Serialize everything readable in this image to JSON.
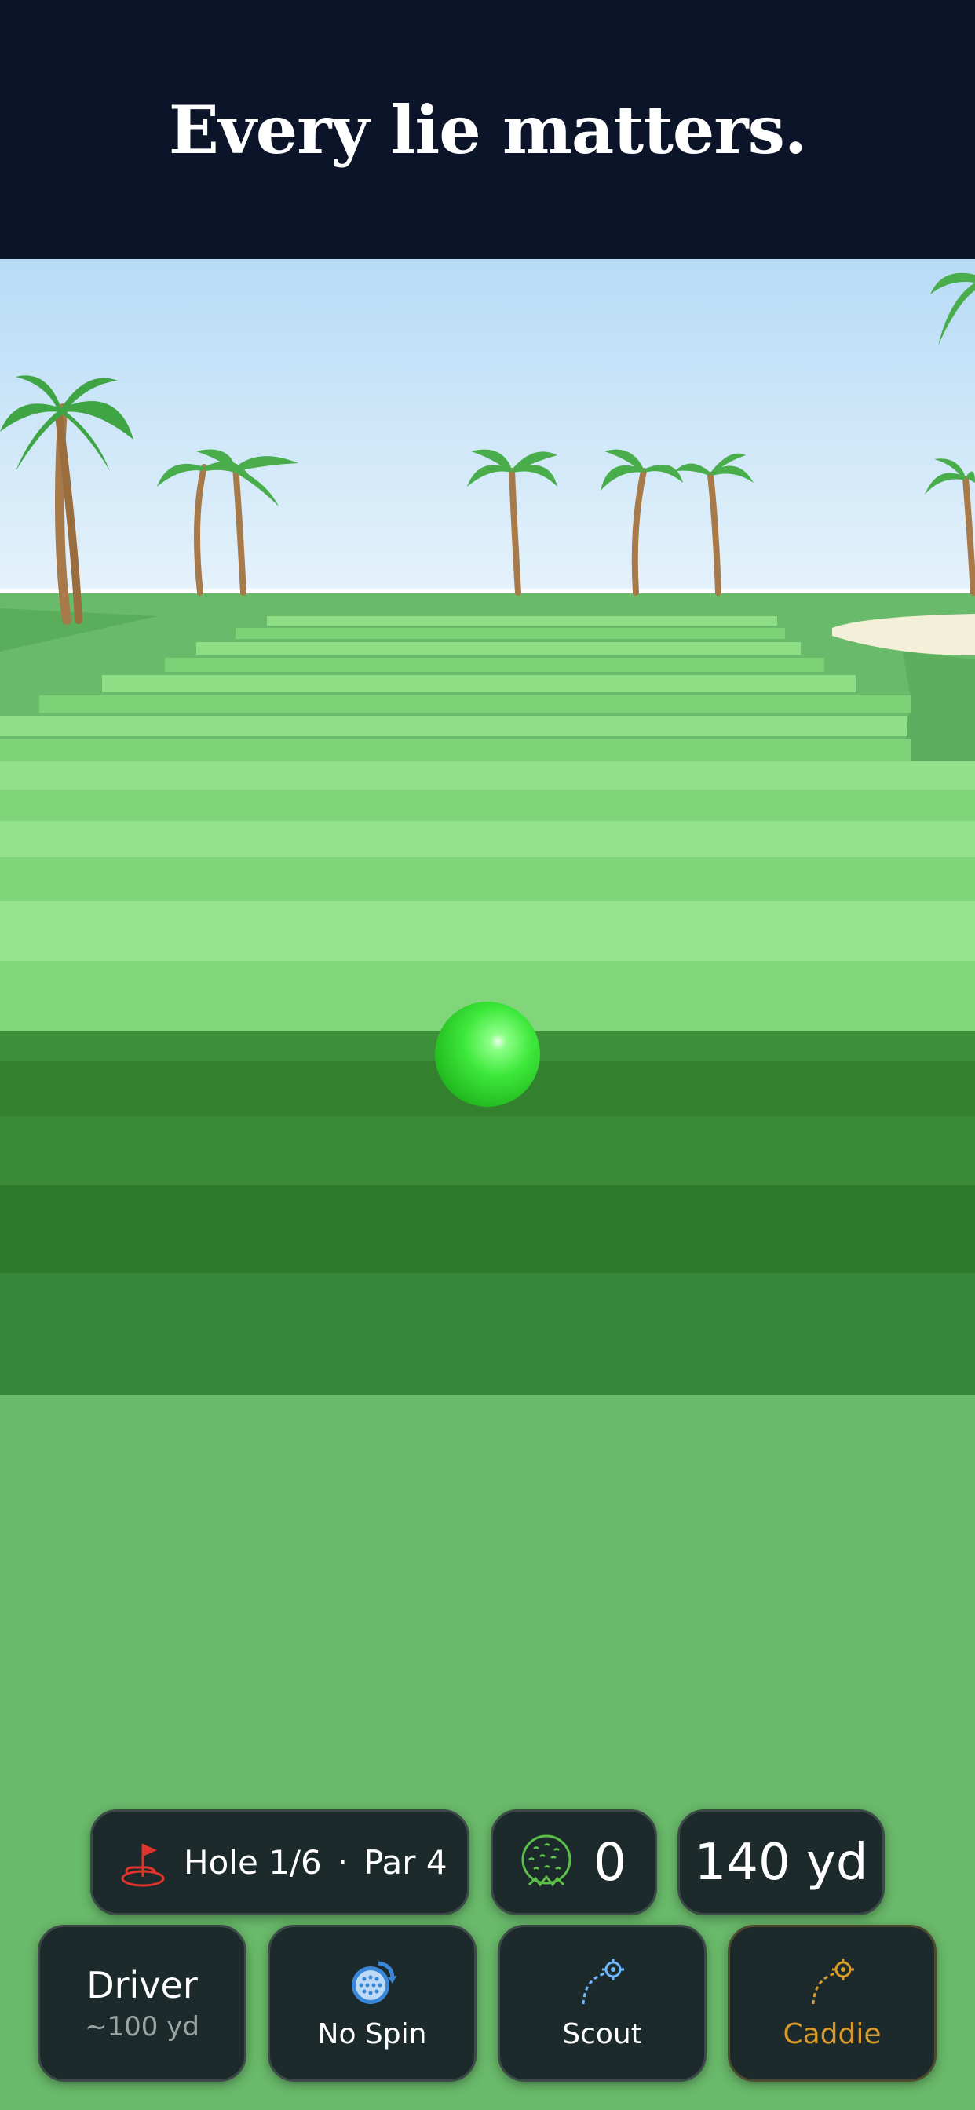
{
  "banner": {
    "title": "Every lie matters."
  },
  "hud": {
    "hole": {
      "label": "Hole 1/6",
      "separator": "·",
      "par": "Par 4"
    },
    "strokes": "0",
    "distance": "140 yd"
  },
  "controls": {
    "club": {
      "name": "Driver",
      "range": "~100 yd"
    },
    "spin": {
      "label": "No Spin"
    },
    "scout": {
      "label": "Scout"
    },
    "caddie": {
      "label": "Caddie"
    }
  },
  "colors": {
    "banner_bg": "#0b1428",
    "ball": "#3de83a",
    "caddie_accent": "#d89a2a",
    "scout_accent": "#6fb8ff",
    "flag_red": "#e0332b"
  }
}
